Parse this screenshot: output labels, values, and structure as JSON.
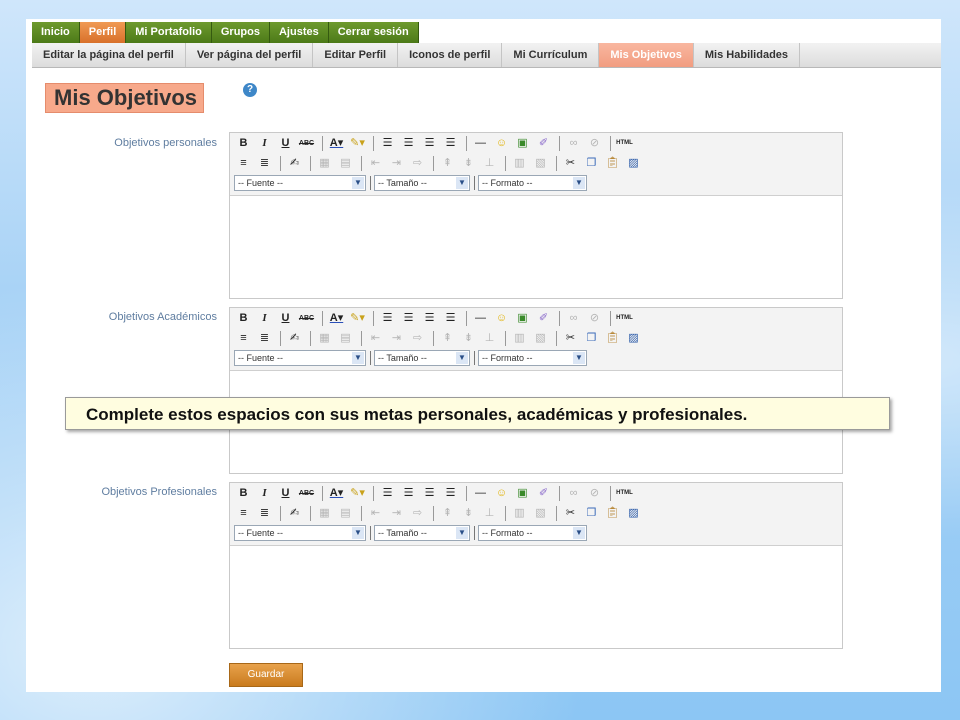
{
  "main_nav": [
    "Inicio",
    "Perfil",
    "Mi Portafolio",
    "Grupos",
    "Ajustes",
    "Cerrar sesión"
  ],
  "sub_nav": [
    "Editar la página del perfil",
    "Ver página del perfil",
    "Editar Perfil",
    "Iconos de perfil",
    "Mi Currículum",
    "Mis Objetivos",
    "Mis Habilidades"
  ],
  "page_title": "Mis Objetivos",
  "help_icon": "help-icon",
  "sections": [
    {
      "label": "Objetivos personales"
    },
    {
      "label": "Objetivos Académicos"
    },
    {
      "label": "Objetivos Profesionales"
    }
  ],
  "toolbar": {
    "font_select": "-- Fuente --",
    "size_select": "-- Tamaño --",
    "format_select": "-- Formato --",
    "bold": "B",
    "italic": "I",
    "underline": "U",
    "strike": "ABC",
    "html": "HTML"
  },
  "tooltip": "Complete estos espacios con sus metas personales, académicas y profesionales.",
  "save_button": "Guardar",
  "colors": {
    "nav_green": "#4c7a18",
    "nav_active": "#d8702a",
    "sub_active": "#f19c80",
    "label": "#5f7da0"
  }
}
